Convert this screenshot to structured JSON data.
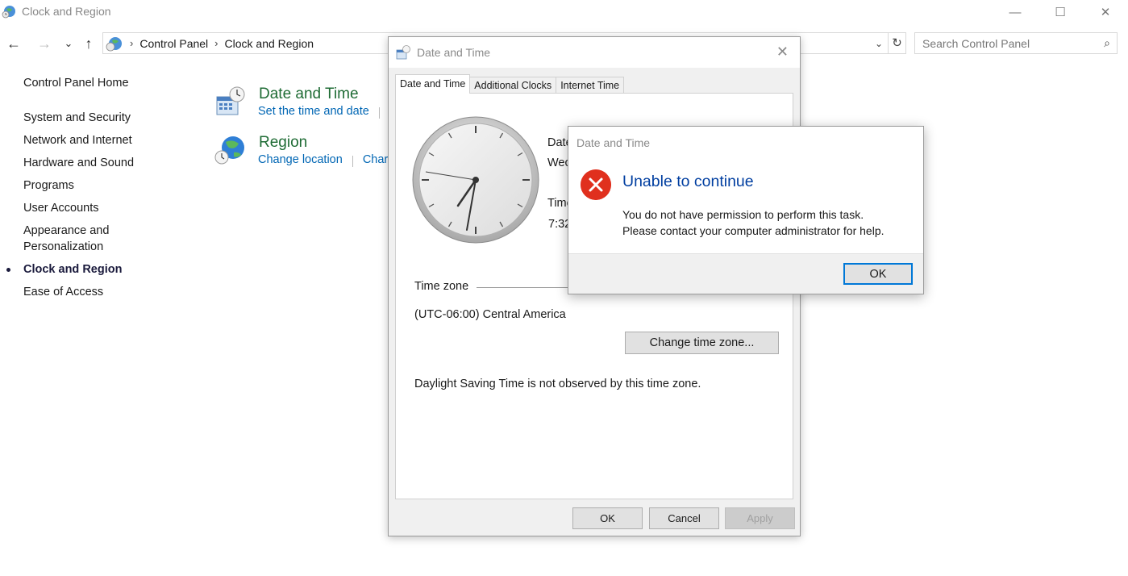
{
  "window": {
    "title": "Clock and Region",
    "minimize": "—",
    "maximize": "☐",
    "close": "✕"
  },
  "nav": {
    "back": "←",
    "forward": "→",
    "recent": "⌄",
    "up": "↑"
  },
  "address": {
    "crumbs": [
      "Control Panel",
      "Clock and Region"
    ],
    "dropdown": "⌄",
    "refresh": "↻"
  },
  "search": {
    "placeholder": "Search Control Panel",
    "icon": "⌕"
  },
  "sidebar": {
    "home": "Control Panel Home",
    "items": [
      {
        "label": "System and Security",
        "active": false
      },
      {
        "label": "Network and Internet",
        "active": false
      },
      {
        "label": "Hardware and Sound",
        "active": false
      },
      {
        "label": "Programs",
        "active": false
      },
      {
        "label": "User Accounts",
        "active": false
      },
      {
        "label": "Appearance and Personalization",
        "active": false
      },
      {
        "label": "Clock and Region",
        "active": true
      },
      {
        "label": "Ease of Access",
        "active": false
      }
    ]
  },
  "categories": [
    {
      "title": "Date and Time",
      "links": [
        "Set the time and date"
      ]
    },
    {
      "title": "Region",
      "links": [
        "Change location",
        "Char"
      ]
    }
  ],
  "datetime_dialog": {
    "title": "Date and Time",
    "close": "✕",
    "tabs": [
      "Date and Time",
      "Additional Clocks",
      "Internet Time"
    ],
    "date_label": "Date",
    "date_value": "Wec",
    "time_label": "Time",
    "time_value": "7:32",
    "timezone_label": "Time zone",
    "timezone_value": "(UTC-06:00) Central America",
    "change_tz_button": "Change time zone...",
    "dst_note": "Daylight Saving Time is not observed by this time zone.",
    "ok": "OK",
    "cancel": "Cancel",
    "apply": "Apply"
  },
  "error_dialog": {
    "title": "Date and Time",
    "heading": "Unable to continue",
    "message_line1": "You do not have permission to perform this task.",
    "message_line2": "Please contact your computer administrator for help.",
    "ok": "OK"
  },
  "colors": {
    "link": "#0066b4",
    "category_title": "#1e6b34",
    "error_heading": "#003ea0",
    "error_icon": "#e0301e",
    "focus": "#0078d7"
  }
}
